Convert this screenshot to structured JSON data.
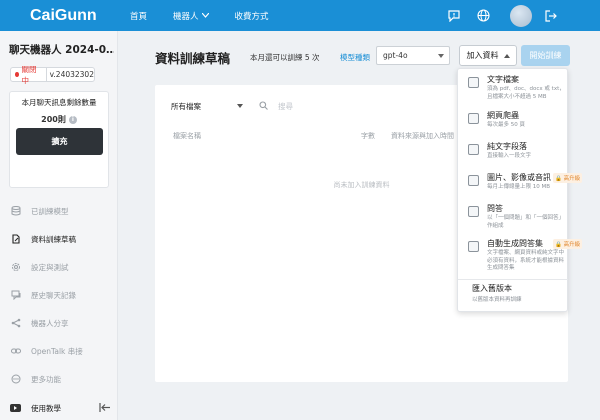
{
  "header": {
    "logo": "CaiGunn",
    "nav": [
      "首頁",
      "機器人",
      "收費方式"
    ]
  },
  "sidebar": {
    "bot_title": "聊天機器人 2024-0…",
    "status": "關閉中",
    "version": "v.24032302",
    "quota_title": "本月聊天訊息剩餘數量",
    "quota_value": "200則",
    "expand_label": "擴充",
    "menu": [
      {
        "label": "已訓練模型",
        "icon": "database-icon",
        "active": false
      },
      {
        "label": "資料訓練草稿",
        "icon": "document-edit-icon",
        "active": true
      },
      {
        "label": "設定與測試",
        "icon": "gear-icon",
        "active": false
      },
      {
        "label": "歷史聊天記錄",
        "icon": "chat-icon",
        "active": false
      },
      {
        "label": "機器人分享",
        "icon": "share-icon",
        "active": false
      },
      {
        "label": "OpenTalk 串接",
        "icon": "link-icon",
        "active": false
      },
      {
        "label": "更多功能",
        "icon": "more-icon",
        "active": false
      }
    ],
    "tutorial": "使用教學"
  },
  "main": {
    "title": "資料訓練草稿",
    "train_note": "本月還可以訓練 5 次",
    "model_label": "模型種類",
    "model_value": "gpt-4o",
    "add_label": "加入資料",
    "start_label": "開始訓練",
    "filter_value": "所有檔案",
    "search_placeholder": "搜尋",
    "columns": [
      "檔案名稱",
      "字數",
      "資料來源與加入時間"
    ],
    "empty_text": "尚未加入訓練資料"
  },
  "dropdown": {
    "items": [
      {
        "label": "文字檔案",
        "desc": "須為 pdf、doc、docx 或 txt，且檔案大小不超過 5 MB",
        "badge": "",
        "icon": "file-icon"
      },
      {
        "label": "網頁爬蟲",
        "desc": "每次最多 50 頁",
        "badge": "",
        "icon": "link-icon"
      },
      {
        "label": "純文字段落",
        "desc": "直接輸入一段文字",
        "badge": "",
        "icon": "text-icon"
      },
      {
        "label": "圖片、影像或音訊",
        "desc": "每月上傳總量上限 10 MB",
        "badge": "🔒 高升級",
        "icon": "image-icon"
      },
      {
        "label": "問答",
        "desc": "以「一個問題」和「一個回答」作組成",
        "badge": "",
        "icon": "qa-icon"
      },
      {
        "label": "自動生成問答集",
        "desc": "文字檔案、網頁資料或純文字中必須有資料，系統才能根據資料生成問答集",
        "badge": "🔒 高升級",
        "icon": "auto-qa-icon"
      }
    ],
    "import_label": "匯入舊版本",
    "import_desc": "以舊版本資料再訓練"
  }
}
